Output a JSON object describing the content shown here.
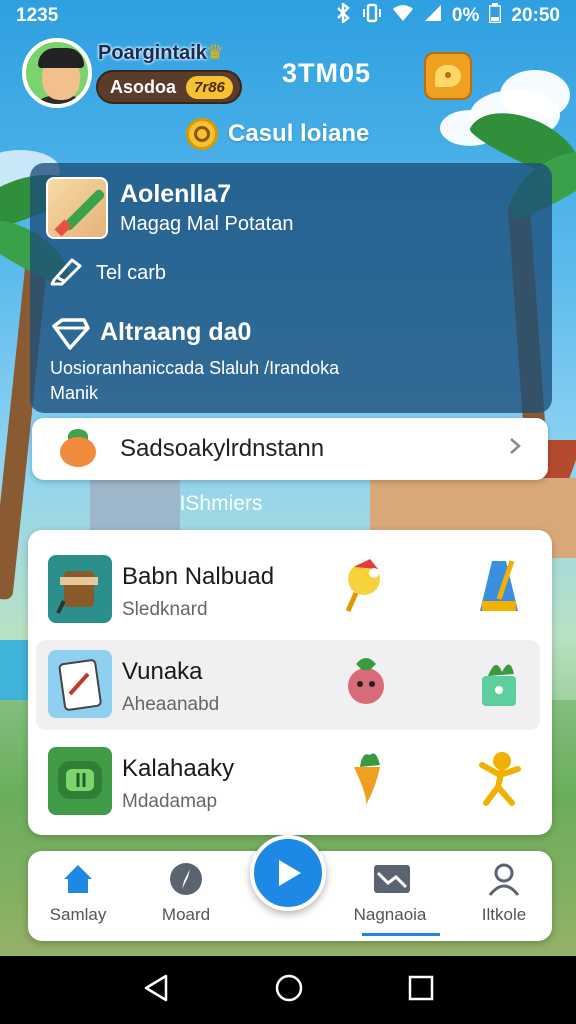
{
  "status_bar": {
    "time_left": "1235",
    "battery_percent": "0%",
    "time_right": "20:50",
    "icons": [
      "bluetooth-icon",
      "vibrate-icon",
      "wifi-icon",
      "signal-icon",
      "battery-icon"
    ]
  },
  "header": {
    "username": "Poargintaik",
    "level_name": "Asodoa",
    "level_badge": "7r86",
    "currency": "3TM05",
    "mode_title": "Casul loiane"
  },
  "info_panel": {
    "title": "Aolenlla7",
    "subtitle": "Magag Mal Potatan",
    "edit_label": "Tel carb",
    "section_title": "Altraang da0",
    "section_body": "Uosioranhaniccada Slaluh /Irandoka Manik"
  },
  "selector": {
    "label": "Sadsoakylrdnstann"
  },
  "subheading": "IShmiers",
  "games": [
    {
      "title": "Babn Nalbuad",
      "subtitle": "Sledknard"
    },
    {
      "title": "Vunaka",
      "subtitle": "Aheaanabd"
    },
    {
      "title": "Kalahaaky",
      "subtitle": "Mdadamap"
    }
  ],
  "bottom_nav": {
    "items": [
      {
        "label": "Samlay",
        "icon": "home-icon"
      },
      {
        "label": "Moard",
        "icon": "compass-icon"
      },
      {
        "label": "Nagnaoia",
        "icon": "chart-icon"
      },
      {
        "label": "Iltkole",
        "icon": "person-icon"
      }
    ],
    "center_icon": "play-icon"
  },
  "colors": {
    "accent": "#1e88e5",
    "panel": "#1c4e7a",
    "badge": "#f6c233"
  }
}
